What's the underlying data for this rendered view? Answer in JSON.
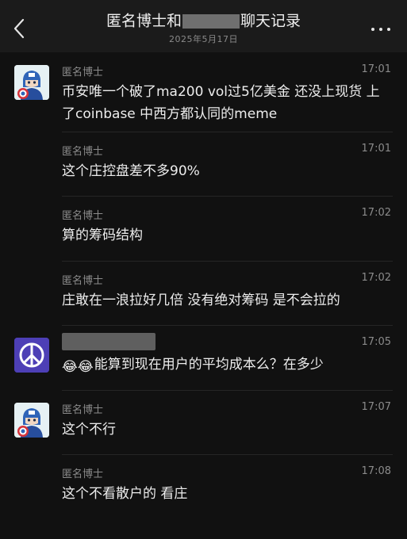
{
  "header": {
    "title_prefix": "匿名博士和",
    "title_suffix": "聊天记录",
    "date": "2025年5月17日",
    "back_icon": "chevron-left-icon",
    "more_icon": "more-dots-icon"
  },
  "messages": [
    {
      "sender": "匿名博士",
      "time": "17:01",
      "text": "币安唯一个破了ma200 vol过5亿美金 还没上现货 上了coinbase 中西方都认同的meme",
      "avatar": "captain-america-avatar"
    },
    {
      "sender": "匿名博士",
      "time": "17:01",
      "text": "这个庄控盘差不多90%"
    },
    {
      "sender": "匿名博士",
      "time": "17:02",
      "text": "算的筹码结构"
    },
    {
      "sender": "匿名博士",
      "time": "17:02",
      "text": "庄敢在一浪拉好几倍 没有绝对筹码 是不会拉的"
    },
    {
      "sender": "",
      "time": "17:05",
      "emoji": "😂😂",
      "text": "能算到现在用户的平均成本么？在多少",
      "avatar": "peace-sign-avatar"
    },
    {
      "sender": "匿名博士",
      "time": "17:07",
      "text": "这个不行",
      "avatar": "captain-america-avatar"
    },
    {
      "sender": "匿名博士",
      "time": "17:08",
      "text": "这个不看散户的 看庄"
    }
  ],
  "colors": {
    "background": "#111111",
    "header": "#1b1b1b",
    "meta_text": "#8b8b8b",
    "message_text": "#ededed",
    "peace_avatar": "#4d3fb6"
  }
}
